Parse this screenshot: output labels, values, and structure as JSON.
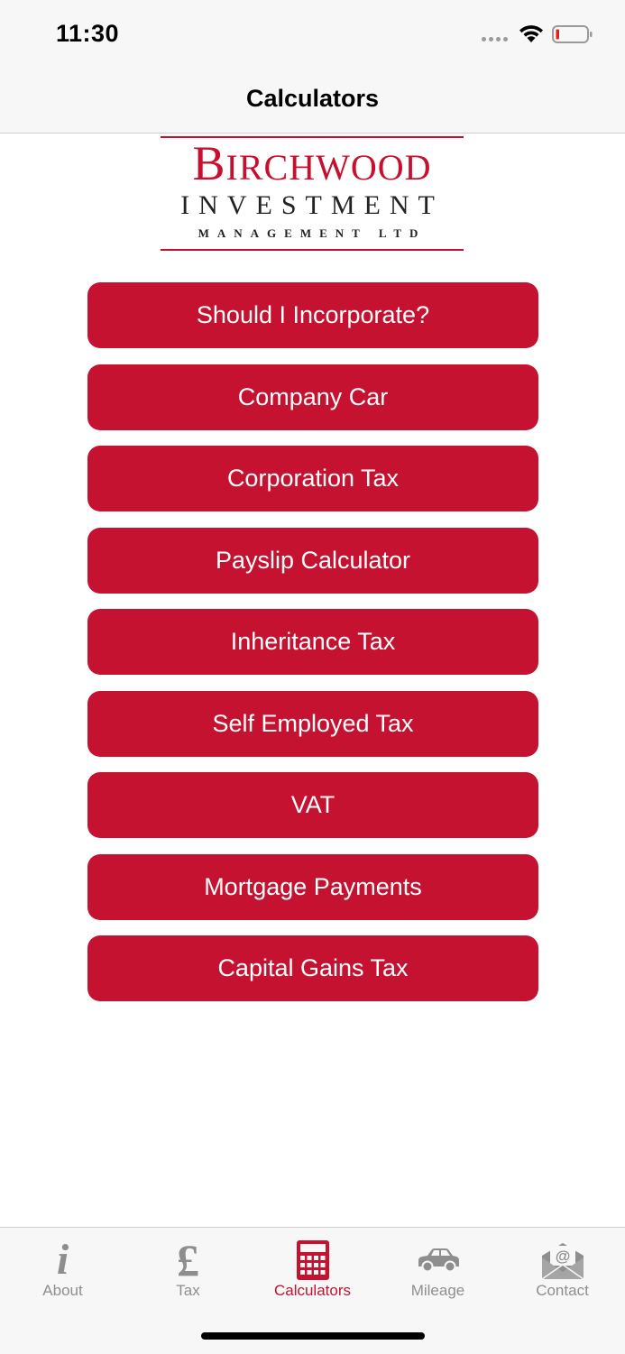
{
  "status": {
    "time": "11:30"
  },
  "nav": {
    "title": "Calculators"
  },
  "logo": {
    "name_first": "B",
    "name_rest": "IRCHWOOD",
    "line2": "INVESTMENT",
    "line3": "MANAGEMENT LTD"
  },
  "buttons": [
    "Should I Incorporate?",
    "Company Car",
    "Corporation Tax",
    "Payslip Calculator",
    "Inheritance Tax",
    "Self Employed Tax",
    "VAT",
    "Mortgage Payments",
    "Capital Gains Tax"
  ],
  "tabs": [
    {
      "label": "About",
      "icon": "info-icon",
      "active": false
    },
    {
      "label": "Tax",
      "icon": "pound-icon",
      "active": false
    },
    {
      "label": "Calculators",
      "icon": "calculator-icon",
      "active": true
    },
    {
      "label": "Mileage",
      "icon": "car-icon",
      "active": false
    },
    {
      "label": "Contact",
      "icon": "email-icon",
      "active": false
    }
  ],
  "colors": {
    "accent": "#c41230",
    "logo_red": "#c8102e",
    "inactive": "#8e8e8e"
  }
}
